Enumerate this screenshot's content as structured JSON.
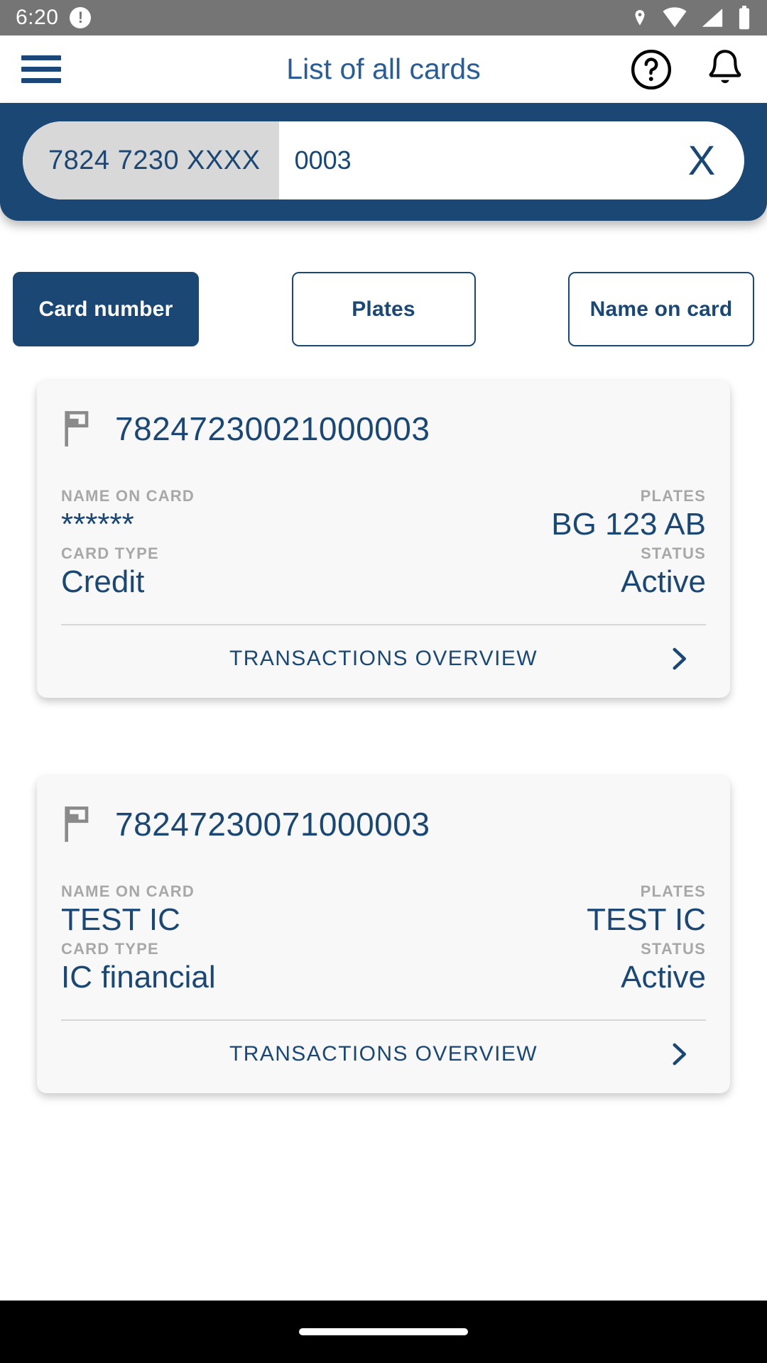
{
  "statusbar": {
    "time": "6:20",
    "warning_icon": "exclamation-circle-icon",
    "icons": [
      "location-pin-icon",
      "wifi-icon",
      "cell-signal-icon",
      "battery-icon"
    ]
  },
  "appbar": {
    "menu_icon": "hamburger-menu-icon",
    "title": "List of all cards",
    "help_icon": "help-circle-icon",
    "notifications_icon": "bell-icon"
  },
  "search": {
    "prefix": "7824 7230 XXXX",
    "value": "0003",
    "placeholder": "",
    "clear_label": "X",
    "background_color": "#1b4775"
  },
  "tabs": [
    {
      "label": "Card number",
      "active": true
    },
    {
      "label": "Plates",
      "active": false
    },
    {
      "label": "Name on card",
      "active": false
    }
  ],
  "labels": {
    "name_on_card": "NAME ON CARD",
    "plates": "PLATES",
    "card_type": "CARD TYPE",
    "status": "STATUS",
    "transactions_overview": "TRANSACTIONS OVERVIEW"
  },
  "cards": [
    {
      "flag_icon": "flag-icon",
      "number": "78247230021000003",
      "name_on_card": "******",
      "plates": "BG 123 AB",
      "card_type": "Credit",
      "status": "Active",
      "action_label": "TRANSACTIONS OVERVIEW",
      "chevron_icon": "chevron-right-icon"
    },
    {
      "flag_icon": "flag-icon",
      "number": "78247230071000003",
      "name_on_card": "TEST IC",
      "plates": "TEST IC",
      "card_type": "IC financial",
      "status": "Active",
      "action_label": "TRANSACTIONS OVERVIEW",
      "chevron_icon": "chevron-right-icon"
    }
  ],
  "colors": {
    "brand_blue": "#1b4775",
    "title_blue": "#2a5d96",
    "label_gray": "#a8a8a8",
    "card_bg": "#f8f8f8",
    "chip_gray": "#d8d8d8",
    "statusbar_gray": "#757575"
  },
  "navbar": {
    "pill": "home-indicator"
  }
}
